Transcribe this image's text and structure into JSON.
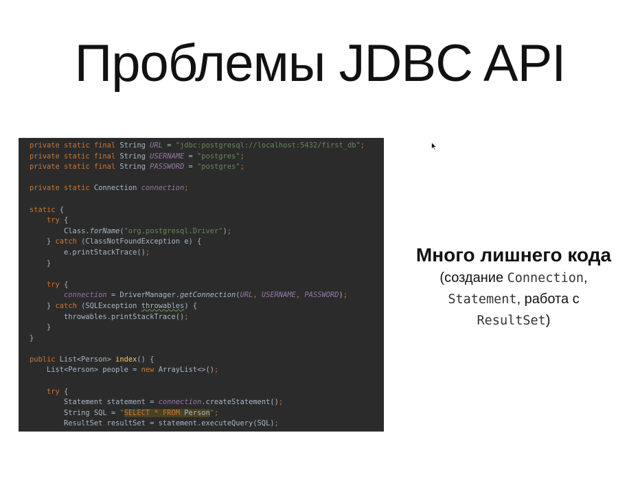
{
  "slide": {
    "title": "Проблемы JDBC API"
  },
  "code": {
    "lines": [
      [
        [
          "kw",
          "private static final "
        ],
        [
          "plain",
          "String "
        ],
        [
          "field",
          "URL"
        ],
        [
          "plain",
          " = "
        ],
        [
          "str",
          "\"jdbc:postgresql://localhost:5432/first_db\""
        ],
        [
          "kw",
          ";"
        ]
      ],
      [
        [
          "kw",
          "private static final "
        ],
        [
          "plain",
          "String "
        ],
        [
          "field",
          "USERNAME"
        ],
        [
          "plain",
          " = "
        ],
        [
          "str",
          "\"postgres\""
        ],
        [
          "kw",
          ";"
        ]
      ],
      [
        [
          "kw",
          "private static final "
        ],
        [
          "plain",
          "String "
        ],
        [
          "field",
          "PASSWORD"
        ],
        [
          "plain",
          " = "
        ],
        [
          "str",
          "\"postgres\""
        ],
        [
          "kw",
          ";"
        ]
      ],
      [],
      [
        [
          "kw",
          "private static "
        ],
        [
          "plain",
          "Connection "
        ],
        [
          "field",
          "connection"
        ],
        [
          "kw",
          ";"
        ]
      ],
      [],
      [
        [
          "kw",
          "static "
        ],
        [
          "plain",
          "{"
        ]
      ],
      [
        [
          "plain",
          "    "
        ],
        [
          "kw",
          "try "
        ],
        [
          "plain",
          "{"
        ]
      ],
      [
        [
          "plain",
          "        Class."
        ],
        [
          "static",
          "forName"
        ],
        [
          "plain",
          "("
        ],
        [
          "str",
          "\"org.postgresql.Driver\""
        ],
        [
          "plain",
          ")"
        ],
        [
          "kw",
          ";"
        ]
      ],
      [
        [
          "plain",
          "    } "
        ],
        [
          "kw",
          "catch "
        ],
        [
          "plain",
          "(ClassNotFoundException e) {"
        ]
      ],
      [
        [
          "plain",
          "        e.printStackTrace()"
        ],
        [
          "kw",
          ";"
        ]
      ],
      [
        [
          "plain",
          "    }"
        ]
      ],
      [],
      [
        [
          "plain",
          "    "
        ],
        [
          "kw",
          "try "
        ],
        [
          "plain",
          "{"
        ]
      ],
      [
        [
          "plain",
          "        "
        ],
        [
          "field",
          "connection"
        ],
        [
          "plain",
          " = DriverManager."
        ],
        [
          "static",
          "getConnection"
        ],
        [
          "plain",
          "("
        ],
        [
          "field",
          "URL"
        ],
        [
          "kw",
          ", "
        ],
        [
          "field",
          "USERNAME"
        ],
        [
          "kw",
          ", "
        ],
        [
          "field",
          "PASSWORD"
        ],
        [
          "plain",
          ")"
        ],
        [
          "kw",
          ";"
        ]
      ],
      [
        [
          "plain",
          "    } "
        ],
        [
          "kw",
          "catch "
        ],
        [
          "plain",
          "(SQLException "
        ],
        [
          "warn",
          "throwables"
        ],
        [
          "plain",
          ") {"
        ]
      ],
      [
        [
          "plain",
          "        throwables.printStackTrace()"
        ],
        [
          "kw",
          ";"
        ]
      ],
      [
        [
          "plain",
          "    }"
        ]
      ],
      [
        [
          "plain",
          "}"
        ]
      ],
      [],
      [
        [
          "kw",
          "public "
        ],
        [
          "plain",
          "List<Person> "
        ],
        [
          "fn",
          "index"
        ],
        [
          "plain",
          "() {"
        ]
      ],
      [
        [
          "plain",
          "    List<Person> people = "
        ],
        [
          "kw",
          "new "
        ],
        [
          "plain",
          "ArrayList<>()"
        ],
        [
          "kw",
          ";"
        ]
      ],
      [],
      [
        [
          "plain",
          "    "
        ],
        [
          "kw",
          "try "
        ],
        [
          "plain",
          "{"
        ]
      ],
      [
        [
          "plain",
          "        Statement statement = "
        ],
        [
          "field",
          "connection"
        ],
        [
          "plain",
          ".createStatement()"
        ],
        [
          "kw",
          ";"
        ]
      ],
      [
        [
          "plain",
          "        String SQL = "
        ],
        [
          "str",
          "\""
        ],
        [
          "hl",
          "SELECT * FROM "
        ],
        [
          "hl2",
          "Person"
        ],
        [
          "str",
          "\""
        ],
        [
          "kw",
          ";"
        ]
      ],
      [
        [
          "plain",
          "        ResultSet resultSet = statement.executeQuery(SQL)"
        ],
        [
          "kw",
          ";"
        ]
      ]
    ]
  },
  "side": {
    "heading": "Много лишнего кода",
    "open_paren": "(создание ",
    "connection_word": "Connection",
    "comma1": ",",
    "statement_word": "Statement",
    "work_with": ", работа с",
    "resultset_word": "ResultSet",
    "close_paren": ")"
  },
  "colors": {
    "code_background": "#2b2b2b",
    "keyword": "#cc7832",
    "string": "#6a8759",
    "field": "#9876aa",
    "plain": "#a9b7c6",
    "function": "#ffc66d"
  },
  "icons": {
    "cursor": "mouse-pointer-icon"
  }
}
